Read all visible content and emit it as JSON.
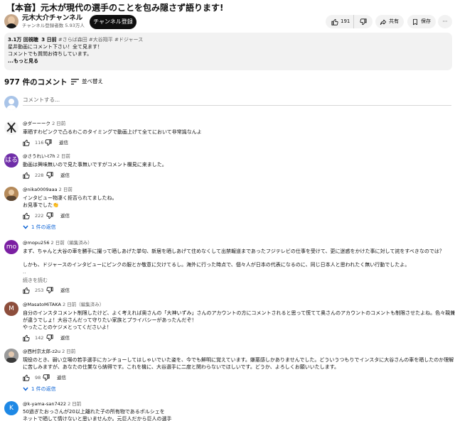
{
  "video": {
    "title": "【本音】元木が現代の選手のことを包み隠さず語ります!",
    "channel_name": "元木大介チャンネル",
    "subscribers": "チャンネル登録者数 5.93万人",
    "subscribe_label": "チャンネル登録",
    "likes": "191",
    "share_label": "共有",
    "save_label": "保存"
  },
  "description": {
    "views": "3.1万 回視聴",
    "age": "3 日前",
    "tags": "#さらば森田 #大谷翔平 #ドジャース",
    "lines": [
      "星井動画にコメント下さい！全て見ます！",
      "コメントでも質問お待ちしています。"
    ],
    "more": "...もっと見る"
  },
  "comments_header": {
    "count": "977 件のコメント",
    "sort_label": "並べ替え",
    "add_placeholder": "コメントする..."
  },
  "comments": [
    {
      "author": "@ダーーーク",
      "time": "2 日前",
      "lines": [
        "車晒すわピンクで凸るわこのタイミングで動画上げて全てにおいて非常識なんよ"
      ],
      "likes": "116",
      "reply": "返信",
      "avatar_color": "#f5f5f5"
    },
    {
      "author": "@さうれい-t7h",
      "time": "2 日前",
      "lines": [
        "動画は興味無いので見た事無いですがコメント欄見に来ました。"
      ],
      "likes": "228",
      "reply": "返信",
      "avatar_text": "はる",
      "avatar_color": "#6f2da8"
    },
    {
      "author": "@nika0009aaa",
      "time": "2 日前",
      "lines": [
        "インタビュー物凄く拒否られてましたね。",
        "お見事でした👏"
      ],
      "likes": "222",
      "reply": "返信",
      "replies": "1 件の返信",
      "avatar_color": "#b58a5a"
    },
    {
      "author": "@mopu256",
      "time": "2 日前（編集済み）",
      "lines": [
        "まず、ちゃんと大谷の車を勝手に撮って晒しあげた挙句、新居を晒しあげて住めなくして出禁報道まであったフジテレビの仕事を受けて、更に迷惑をかけた事に対して詫をすべきなのでは？",
        "",
        "しかも、ドジャースのインタビューにピンクの服とか敬意に欠けてるし。海外に行った時点で、個々人が日本の代表になるのに、同じ日本人と思われたく無い行動でしたよ。",
        ".."
      ],
      "read_more": "続きを読む",
      "likes": "253",
      "reply": "返信",
      "avatar_text": "mo",
      "avatar_color": "#7b1fa2"
    },
    {
      "author": "@MasatoMiTAKA",
      "time": "2 日前（編集済み）",
      "lines": [
        "自分のインスタコメント制限したけど、よく考えれば奥さんの「大神いずみ」さんのアカウントの方にコメントされると思って慌てて奥さんのアカウントのコメントも制限させたよね。色々親兼",
        "が違うでしょ！大谷さんだって守りたい家族とプライバシーがあったんだぞ！",
        "やったことのケジメとってくださいよ！"
      ],
      "likes": "142",
      "reply": "返信",
      "avatar_text": "M",
      "avatar_color": "#8d4e3c"
    },
    {
      "author": "@西村京太郎-z2u",
      "time": "2 日前",
      "lines": [
        "現役のとき、弱い立場の若手選手にカンチョーしてはしゃいでいた姿を、今でも鮮明に覚えています。嫌悪感しかありませんでした。どういうつもりでインスタに大谷さんの車を晒したのか理解",
        "に苦しみますが、あなたの仕業なら納得です。これを機に、大谷選手に二度と関わらないでほしいです。どうか、よろしくお願いいたします。"
      ],
      "likes": "98",
      "reply": "返信",
      "replies": "1 件の返信",
      "avatar_color": "#9a9a9a"
    },
    {
      "author": "@k-yama-san7422",
      "time": "2 日前",
      "lines": [
        "50過ぎたおっさんが20以上離れた子の所有物であるポルシェを",
        "ネットで晒して情けないと思いませんか。元巨人だから巨人の選手"
      ],
      "avatar_text": "K",
      "avatar_color": "#1e88e5"
    }
  ],
  "colors": {
    "accent_link": "#065fd4",
    "subscribe_bg": "#0f0f0f",
    "pill_bg": "#f2f2f2"
  },
  "icons": [
    "like-icon",
    "dislike-icon",
    "share-icon",
    "save-icon",
    "more-icon",
    "sort-icon",
    "chevron-down-icon"
  ]
}
